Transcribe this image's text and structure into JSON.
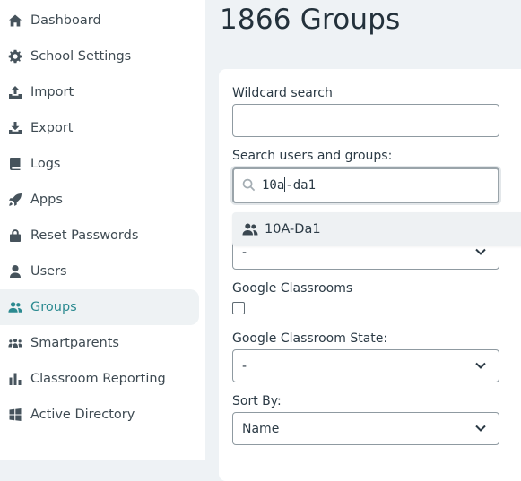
{
  "sidebar": {
    "items": [
      {
        "label": "Dashboard",
        "icon": "home-icon",
        "active": false
      },
      {
        "label": "School Settings",
        "icon": "gear-icon",
        "active": false
      },
      {
        "label": "Import",
        "icon": "upload-icon",
        "active": false
      },
      {
        "label": "Export",
        "icon": "download-icon",
        "active": false
      },
      {
        "label": "Logs",
        "icon": "book-icon",
        "active": false
      },
      {
        "label": "Apps",
        "icon": "rocket-icon",
        "active": false
      },
      {
        "label": "Reset Passwords",
        "icon": "lock-icon",
        "active": false
      },
      {
        "label": "Users",
        "icon": "user-icon",
        "active": false
      },
      {
        "label": "Groups",
        "icon": "users-icon",
        "active": true
      },
      {
        "label": "Smartparents",
        "icon": "people-group-icon",
        "active": false
      },
      {
        "label": "Classroom Reporting",
        "icon": "bar-chart-icon",
        "active": false
      },
      {
        "label": "Active Directory",
        "icon": "windows-icon",
        "active": false
      }
    ]
  },
  "main": {
    "title": "1866 Groups",
    "wildcard": {
      "label": "Wildcard search",
      "value": ""
    },
    "search": {
      "label": "Search users and groups:",
      "value_before_caret": "10a",
      "value_after_caret": "-da1",
      "result": "10A-Da1"
    },
    "hidden_select": {
      "value": "-"
    },
    "google_classrooms": {
      "label": "Google Classrooms",
      "checked": false
    },
    "google_classroom_state": {
      "label": "Google Classroom State:",
      "value": "-"
    },
    "sort_by": {
      "label": "Sort By:",
      "value": "Name"
    }
  },
  "colors": {
    "accent": "#2b8a90",
    "active_bg": "#eef2f4",
    "page_bg": "#eef2f5"
  }
}
